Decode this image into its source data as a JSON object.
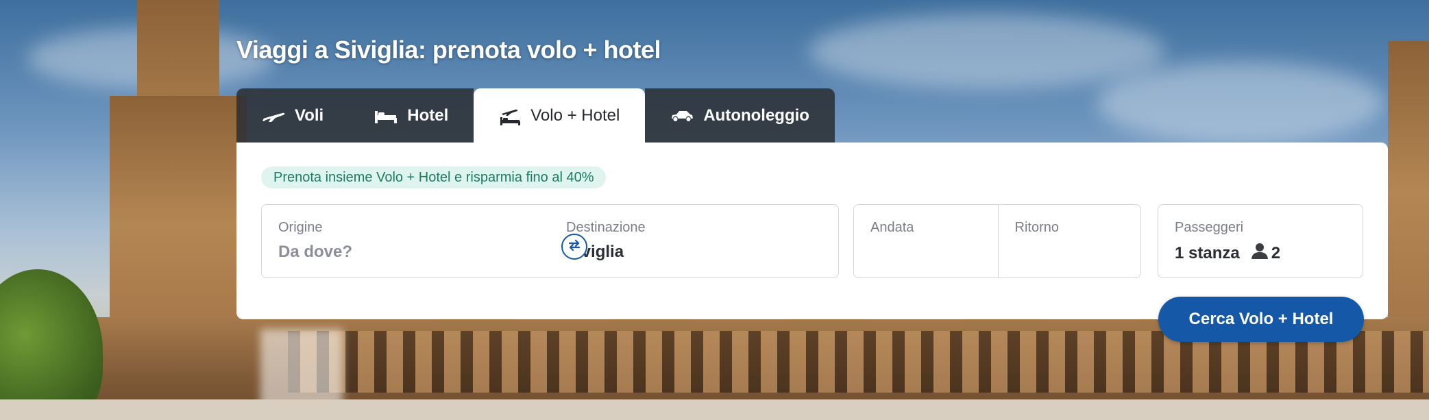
{
  "page": {
    "title": "Viaggi a Siviglia: prenota volo + hotel"
  },
  "tabs": [
    {
      "label": "Voli",
      "icon": "plane-icon",
      "active": false
    },
    {
      "label": "Hotel",
      "icon": "bed-icon",
      "active": false
    },
    {
      "label": "Volo + Hotel",
      "icon": "plane-bed-icon",
      "active": true
    },
    {
      "label": "Autonoleggio",
      "icon": "car-icon",
      "active": false
    }
  ],
  "promo": {
    "text": "Prenota insieme Volo + Hotel e risparmia fino al 40%"
  },
  "search": {
    "origin": {
      "label": "Origine",
      "placeholder": "Da dove?"
    },
    "destination": {
      "label": "Destinazione",
      "value": "Siviglia"
    },
    "departure": {
      "label": "Andata"
    },
    "return": {
      "label": "Ritorno"
    },
    "passengers": {
      "label": "Passeggeri",
      "rooms": "1 stanza",
      "people": "2"
    },
    "submit_label": "Cerca Volo + Hotel"
  },
  "colors": {
    "accent": "#1558a8",
    "promo_bg": "#e0f4ef",
    "promo_text": "#1c7a60",
    "tab_bg": "#2c3036"
  }
}
